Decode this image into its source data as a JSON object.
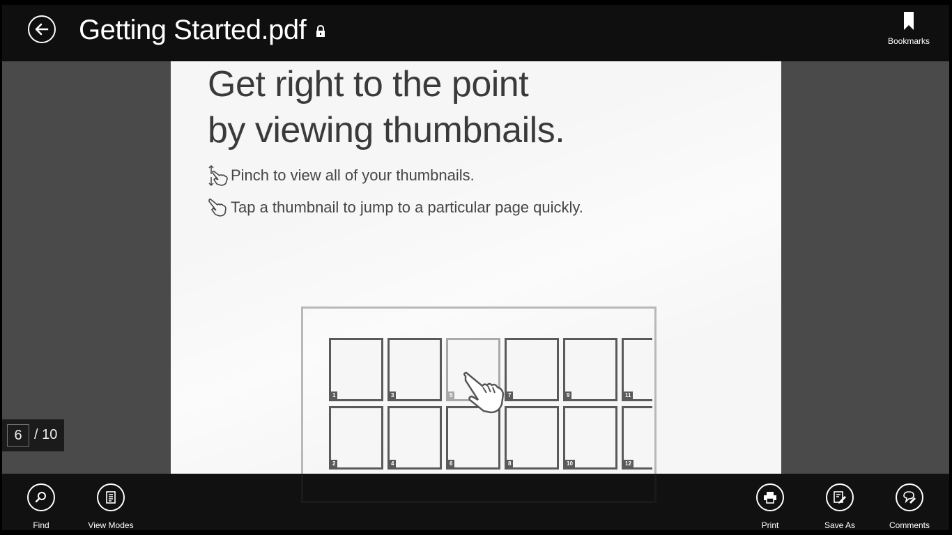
{
  "header": {
    "title": "Getting Started.pdf",
    "bookmarks_label": "Bookmarks"
  },
  "document": {
    "heading_line1": "Get right to the point",
    "heading_line2": "by viewing thumbnails.",
    "bullets": [
      "Pinch to view all of your thumbnails.",
      "Tap a thumbnail to jump to a particular page quickly."
    ],
    "thumbnails_top": [
      "1",
      "3",
      "5",
      "7",
      "9",
      "11"
    ],
    "thumbnails_bottom": [
      "2",
      "4",
      "6",
      "8",
      "10",
      "12"
    ],
    "selected_thumbnail": "5"
  },
  "page_indicator": {
    "current": "6",
    "total": "/ 10"
  },
  "appbar": {
    "find_label": "Find",
    "view_modes_label": "View Modes",
    "print_label": "Print",
    "save_as_label": "Save As",
    "comments_label": "Comments"
  },
  "colors": {
    "appbar_bg": "#0c0c0c",
    "canvas_bg": "#4a4a4a",
    "page_bg": "#f6f6f6",
    "thumb_border": "#5a5a5a"
  }
}
